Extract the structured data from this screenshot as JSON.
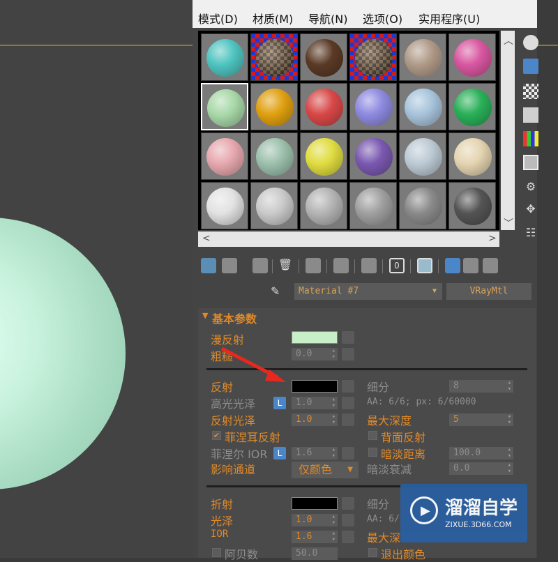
{
  "menu": {
    "items": [
      "模式(D)",
      "材质(M)",
      "导航(N)",
      "选项(O)",
      "实用程序(U)"
    ]
  },
  "slots": {
    "colors": [
      [
        "#4fc4c0",
        "checker",
        "#5a3a25",
        "checker",
        "#b09a88",
        "#d857a0"
      ],
      [
        "#a8d8a8",
        "#e0a010",
        "#d84848",
        "#8e8ae0",
        "#a8c4dc",
        "#2ab058"
      ],
      [
        "#e6a8ae",
        "#9cc0ac",
        "#e0dc40",
        "#7a58b0",
        "#bccad4",
        "#e4d4b0"
      ],
      [
        "#e2e2e2",
        "#cacaca",
        "#b4b4b4",
        "#a0a0a0",
        "#8a8a8a",
        "#545454"
      ]
    ],
    "selected_row": 1,
    "selected_col": 0
  },
  "material": {
    "name": "Material #7",
    "type": "VRayMtl"
  },
  "rollout": {
    "title": "基本参数",
    "diffuse": {
      "label": "漫反射",
      "color": "#c8f0c8"
    },
    "roughness": {
      "label": "粗糙",
      "value": "0.0"
    },
    "reflection": {
      "label": "反射",
      "color": "#000000",
      "subdiv_label": "细分",
      "subdiv_value": "8",
      "glossy_label": "高光光泽",
      "glossy_value": "1.0",
      "aa_text": "AA: 6/6; px: 6/60000",
      "refl_gloss_label": "反射光泽",
      "refl_gloss_value": "1.0",
      "max_depth_label": "最大深度",
      "max_depth_value": "5",
      "fresnel_label": "菲涅耳反射",
      "back_side_label": "背面反射",
      "fresnel_ior_label": "菲涅尔 IOR",
      "fresnel_ior_value": "1.6",
      "dim_dist_label": "暗淡距离",
      "dim_dist_value": "100.0",
      "affect_label": "影响通道",
      "affect_value": "仅颜色",
      "dim_falloff_label": "暗淡衰减",
      "dim_falloff_value": "0.0"
    },
    "refraction": {
      "label": "折射",
      "color": "#000000",
      "subdiv_label": "细分",
      "gloss_label": "光泽",
      "gloss_value": "1.0",
      "aa_text": "AA: 6/",
      "ior_label": "IOR",
      "ior_value": "1.6",
      "max_depth_label": "最大深",
      "abbe_label": "阿贝数",
      "abbe_value": "50.0",
      "exit_color_label": "退出颜色"
    }
  },
  "watermark": {
    "title": "溜溜自学",
    "url": "ZIXUE.3D66.COM"
  }
}
